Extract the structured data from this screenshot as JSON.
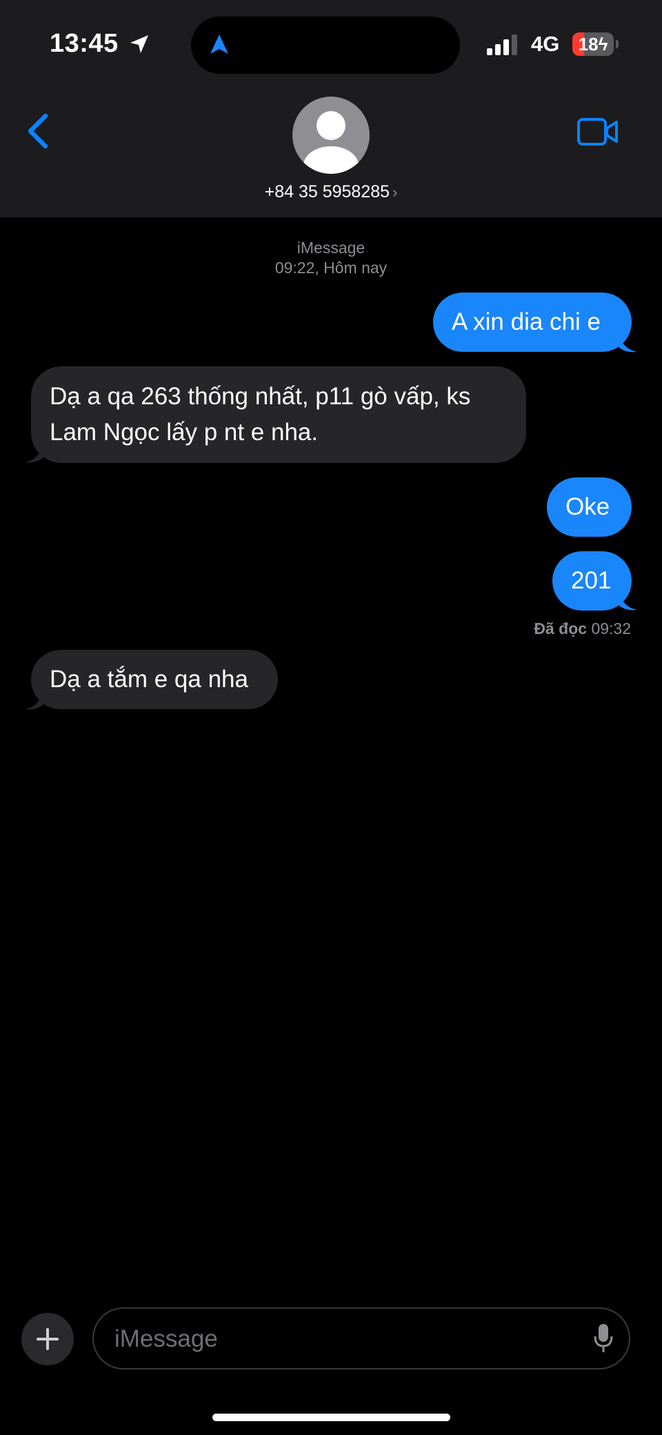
{
  "status_bar": {
    "time": "13:45",
    "network": "4G",
    "battery": "18",
    "battery_level": 0.18,
    "signal_bars_active": 3,
    "icons": [
      "location-arrow-icon",
      "navigation-icon",
      "signal-icon",
      "battery-charging-icon"
    ]
  },
  "header": {
    "contact_number": "+84 35 5958285",
    "chevron": "›",
    "icons": [
      "back-chevron-icon",
      "avatar-icon",
      "video-camera-icon"
    ],
    "accent_color": "#0a84ff"
  },
  "conversation": {
    "service": "iMessage",
    "timestamp": "09:22, Hôm nay",
    "messages": [
      {
        "direction": "outgoing",
        "text": "A xin dia chi e"
      },
      {
        "direction": "incoming",
        "text": "Dạ a qa 263 thống nhất, p11 gò vấp, ks Lam Ngọc lấy p nt e nha."
      },
      {
        "direction": "outgoing",
        "text": "Oke"
      },
      {
        "direction": "outgoing",
        "text": "201"
      },
      {
        "direction": "incoming",
        "text": "Dạ a tắm e qa nha"
      }
    ],
    "read_receipt": {
      "label": "Đã đọc",
      "time": "09:32"
    },
    "colors": {
      "outgoing": "#1a86fb",
      "incoming": "#262628"
    }
  },
  "input_bar": {
    "placeholder": "iMessage",
    "icons": [
      "plus-icon",
      "microphone-icon"
    ]
  }
}
